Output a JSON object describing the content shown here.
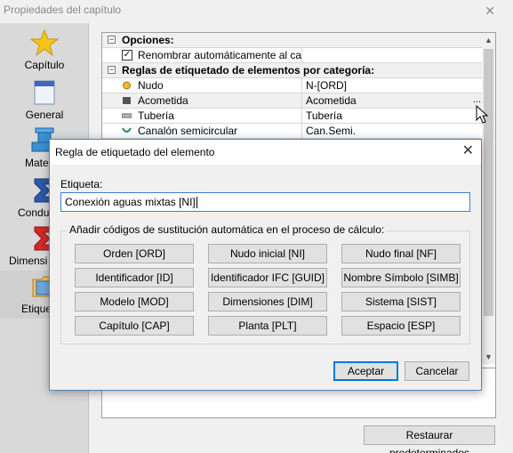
{
  "window": {
    "title": "Propiedades del capítulo",
    "close": "✕"
  },
  "sidebar": {
    "items": [
      {
        "label": "Capítulo",
        "icon": "star-icon"
      },
      {
        "label": "General",
        "icon": "document-icon"
      },
      {
        "label": "Mater",
        "icon": "pipe-icon"
      },
      {
        "label": "Condu",
        "icon": "sigma-icon"
      },
      {
        "label": "Dimensi",
        "icon": "sigma-icon"
      },
      {
        "label": "Etique",
        "icon": "folder-icon"
      }
    ]
  },
  "grid": {
    "options_header": "Opciones:",
    "rename_auto": "Renombrar automáticamente al calc...",
    "rules_header": "Reglas de etiquetado de elementos por categoría:",
    "rows": [
      {
        "name": "Nudo",
        "value": "N-[ORD]"
      },
      {
        "name": "Acometida",
        "value": "Acometida"
      },
      {
        "name": "Tubería",
        "value": "Tubería"
      },
      {
        "name": "Canalón semicircular",
        "value": "Can.Semi."
      }
    ],
    "dots": "..."
  },
  "restore_button": "Restaurar predeterminados",
  "dialog": {
    "title": "Regla de etiquetado del elemento",
    "close": "✕",
    "label": "Etiqueta:",
    "input_value": "Conexión aguas mixtas [NI]",
    "group_title": "Añadir códigos de sustitución automática en el proceso de cálculo:",
    "codes": [
      "Orden [ORD]",
      "Nudo inicial [NI]",
      "Nudo final [NF]",
      "Identificador [ID]",
      "Identificador IFC [GUID]",
      "Nombre Símbolo [SIMB]",
      "Modelo [MOD]",
      "Dimensiones [DIM]",
      "Sistema [SIST]",
      "Capítulo [CAP]",
      "Planta [PLT]",
      "Espacio [ESP]"
    ],
    "accept": "Aceptar",
    "cancel": "Cancelar"
  },
  "colors": {
    "accent": "#0078d7",
    "star": "#f5c518",
    "sigma": "#2e5aa8",
    "sigma_red": "#d42a2a"
  }
}
